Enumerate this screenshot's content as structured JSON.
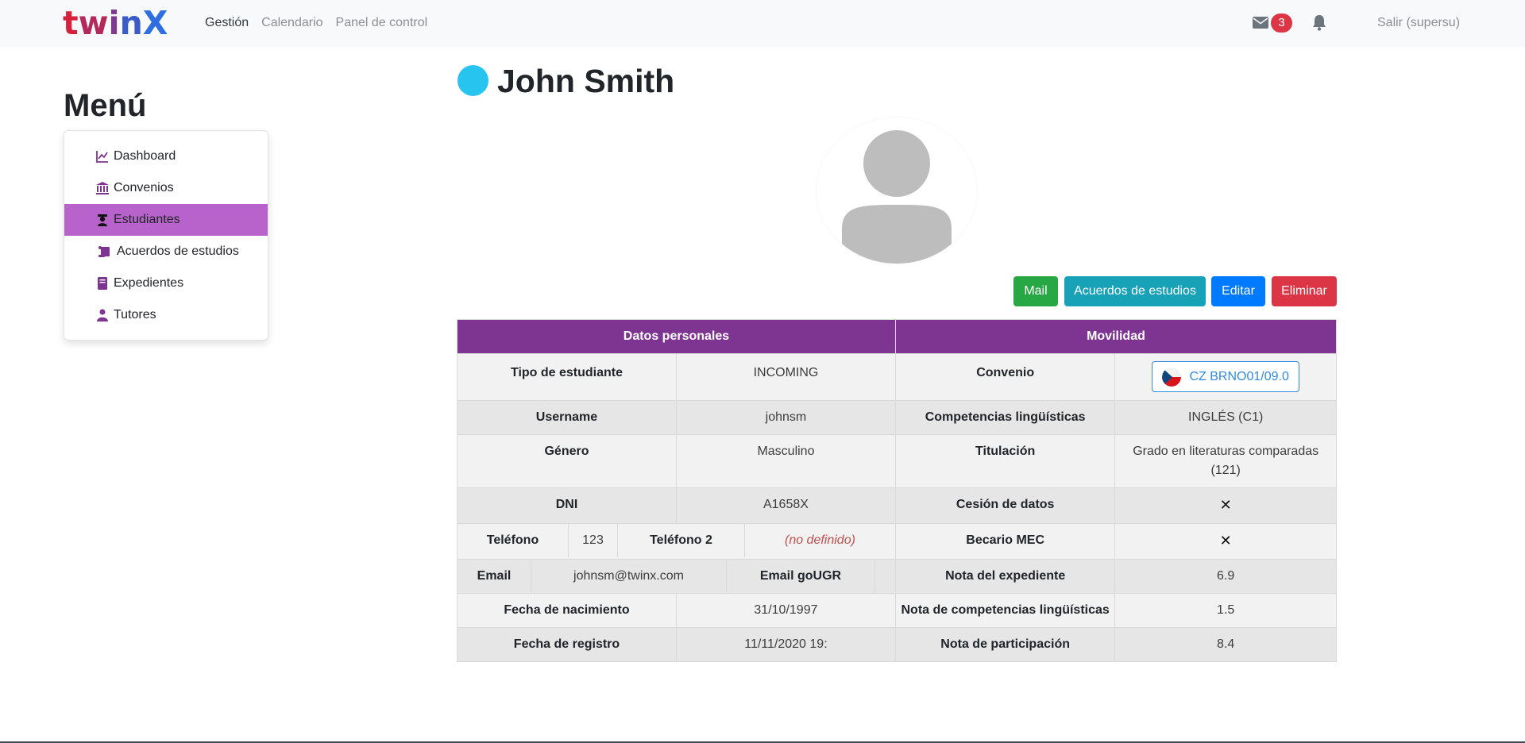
{
  "brand": {
    "part1": "t",
    "part2": "w",
    "part3": "i",
    "part4": "n",
    "part5": "X"
  },
  "nav": {
    "links": [
      "Gestión",
      "Calendario",
      "Panel de control"
    ],
    "mail_count": "3",
    "logout": "Salir (supersu)"
  },
  "sidebar": {
    "title": "Menú",
    "items": [
      {
        "label": "Dashboard",
        "icon": "chart-line-icon"
      },
      {
        "label": "Convenios",
        "icon": "bank-icon"
      },
      {
        "label": "Estudiantes",
        "icon": "graduate-icon",
        "active": true
      },
      {
        "label": "Acuerdos de estudios",
        "icon": "scroll-icon"
      },
      {
        "label": "Expedientes",
        "icon": "book-icon"
      },
      {
        "label": "Tutores",
        "icon": "teacher-icon"
      }
    ]
  },
  "student": {
    "name": "John Smith",
    "status_color": "#28c4f0"
  },
  "actions": {
    "mail": "Mail",
    "acuerdos": "Acuerdos de estudios",
    "editar": "Editar",
    "eliminar": "Eliminar"
  },
  "table": {
    "header_personal": "Datos personales",
    "header_movilidad": "Movilidad",
    "tipo_label": "Tipo de estudiante",
    "tipo_value": "INCOMING",
    "convenio_label": "Convenio",
    "convenio_value": "CZ BRNO01/09.0",
    "username_label": "Username",
    "username_value": "johnsm",
    "competencias_label": "Competencias lingüísticas",
    "competencias_value": "INGLÉS (C1)",
    "genero_label": "Género",
    "genero_value": "Masculino",
    "titulacion_label": "Titulación",
    "titulacion_value": "Grado en literaturas comparadas (121)",
    "dni_label": "DNI",
    "dni_value": "A1658X",
    "cesion_label": "Cesión de datos",
    "cesion_value": "✕",
    "telefono_label": "Teléfono",
    "telefono_value": "123",
    "telefono2_label": "Teléfono 2",
    "telefono2_value": "(no definido)",
    "becario_label": "Becario MEC",
    "becario_value": "✕",
    "email_label": "Email",
    "email_value": "johnsm@twinx.com",
    "email_go_label": "Email goUGR",
    "email_go_value": "",
    "nota_exp_label": "Nota del expediente",
    "nota_exp_value": "6.9",
    "nacimiento_label": "Fecha de nacimiento",
    "nacimiento_value": "31/10/1997",
    "nota_comp_label": "Nota de competencias lingüísticas",
    "nota_comp_value": "1.5",
    "registro_label": "Fecha de registro",
    "registro_value": "11/11/2020 19:",
    "nota_part_label": "Nota de participación",
    "nota_part_value": "8.4"
  },
  "colors": {
    "header_purple": "#7e3592",
    "active_menu": "#b763cb",
    "mail_green": "#28a745",
    "info_teal": "#17a2b8",
    "primary_blue": "#007bff",
    "danger_red": "#dc3545"
  }
}
